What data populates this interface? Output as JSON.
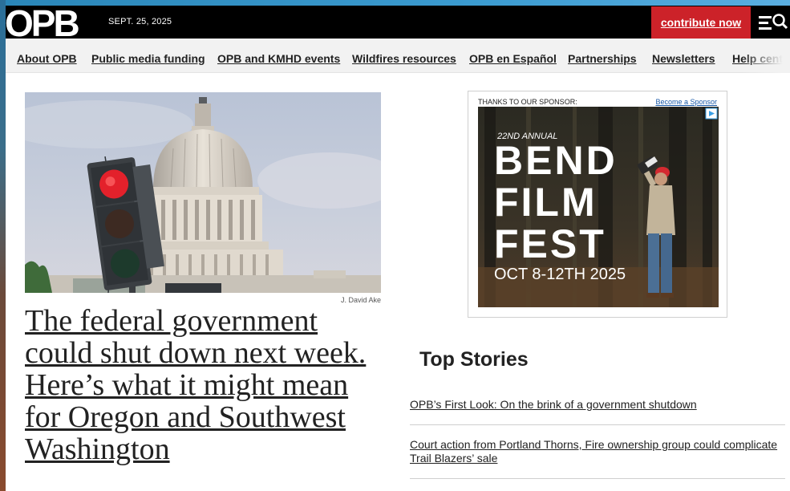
{
  "header": {
    "logo_text": "OPB",
    "date": "SEPT. 25, 2025",
    "contribute_label": "contribute now",
    "menu_icon": "hamburger-search-icon"
  },
  "nav": {
    "items": [
      {
        "label": "About OPB"
      },
      {
        "label": "Public media funding"
      },
      {
        "label": "OPB and KMHD events"
      },
      {
        "label": "Wildfires resources"
      },
      {
        "label": "OPB en Español"
      },
      {
        "label": "Partnerships"
      },
      {
        "label": "Newsletters"
      },
      {
        "label": "Help cente"
      }
    ]
  },
  "lead": {
    "image_credit": "J. David Ake",
    "headline": "The federal government could shut down next week. Here’s what it might mean for Oregon and Southwest Washington"
  },
  "sponsor": {
    "label": "THANKS TO OUR SPONSOR:",
    "link": "Become a Sponsor",
    "ad": {
      "annual": "22ND ANNUAL",
      "line1": "BEND",
      "line2": "FILM",
      "line3": "FEST",
      "dates": "OCT 8-12TH 2025"
    }
  },
  "top_stories": {
    "title": "Top Stories",
    "items": [
      {
        "text": "OPB’s First Look: On the brink of a government shutdown"
      },
      {
        "text": "Court action from Portland Thorns, Fire ownership group could complicate Trail Blazers’ sale"
      }
    ]
  },
  "colors": {
    "brand_black": "#000000",
    "contribute_red": "#cc2229",
    "nav_bg": "#f2f2f2",
    "link_blue": "#1a5aa8"
  }
}
